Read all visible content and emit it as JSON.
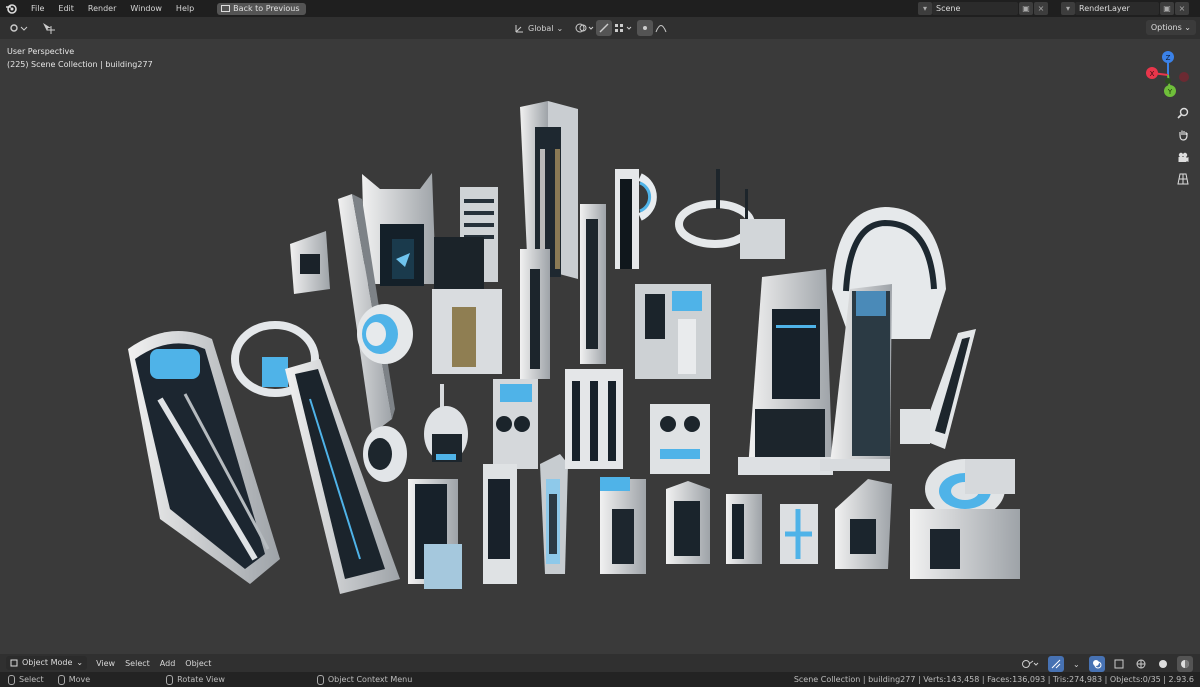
{
  "menu": {
    "items": [
      "File",
      "Edit",
      "Render",
      "Window",
      "Help"
    ],
    "back_button": "Back to Previous"
  },
  "scene": {
    "name": "Scene"
  },
  "render_layer": {
    "name": "RenderLayer"
  },
  "header": {
    "transform_orientation": "Global",
    "options": "Options"
  },
  "viewport": {
    "view_name": "User Perspective",
    "collection_info": "(225) Scene Collection | building277",
    "gizmo_axes": [
      "Z",
      "X",
      "Y"
    ]
  },
  "bottom": {
    "mode": "Object Mode",
    "menus": [
      "View",
      "Select",
      "Add",
      "Object"
    ]
  },
  "status": {
    "select": "Select",
    "move": "Move",
    "rotate": "Rotate View",
    "context": "Object Context Menu",
    "stats": "Scene Collection | building277 | Verts:143,458 | Faces:136,093 | Tris:274,983 | Objects:0/35 | 2.93.6"
  },
  "colors": {
    "accent_blue": "#4fb3e8",
    "axis_x": "#e8364b",
    "axis_y": "#6fbf3a",
    "axis_z": "#3b82e8"
  }
}
